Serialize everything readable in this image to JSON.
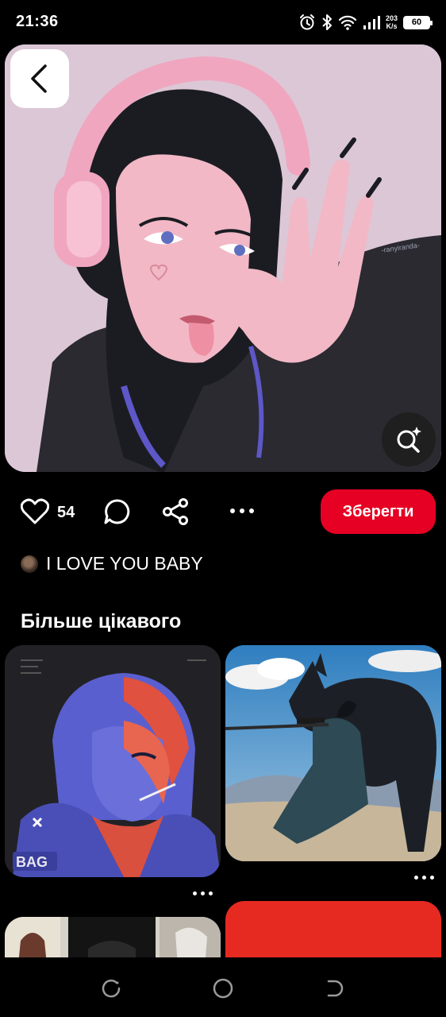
{
  "status_bar": {
    "time": "21:36",
    "speed_value": "203",
    "speed_unit": "K/s",
    "battery": "60",
    "icons": [
      "alarm-icon",
      "bluetooth-icon",
      "wifi-icon",
      "signal-icon",
      "battery-icon"
    ]
  },
  "pin": {
    "like_count": "54",
    "save_label": "Зберегти",
    "author_name": "I LOVE YOU BABY",
    "hero_signature": "-ranyiranda-"
  },
  "more_section": {
    "title": "Більше цікавого",
    "card_1_text": "BAG"
  },
  "colors": {
    "save_button": "#e60023",
    "background": "#000000",
    "hero_background": "#dcc7d6"
  }
}
